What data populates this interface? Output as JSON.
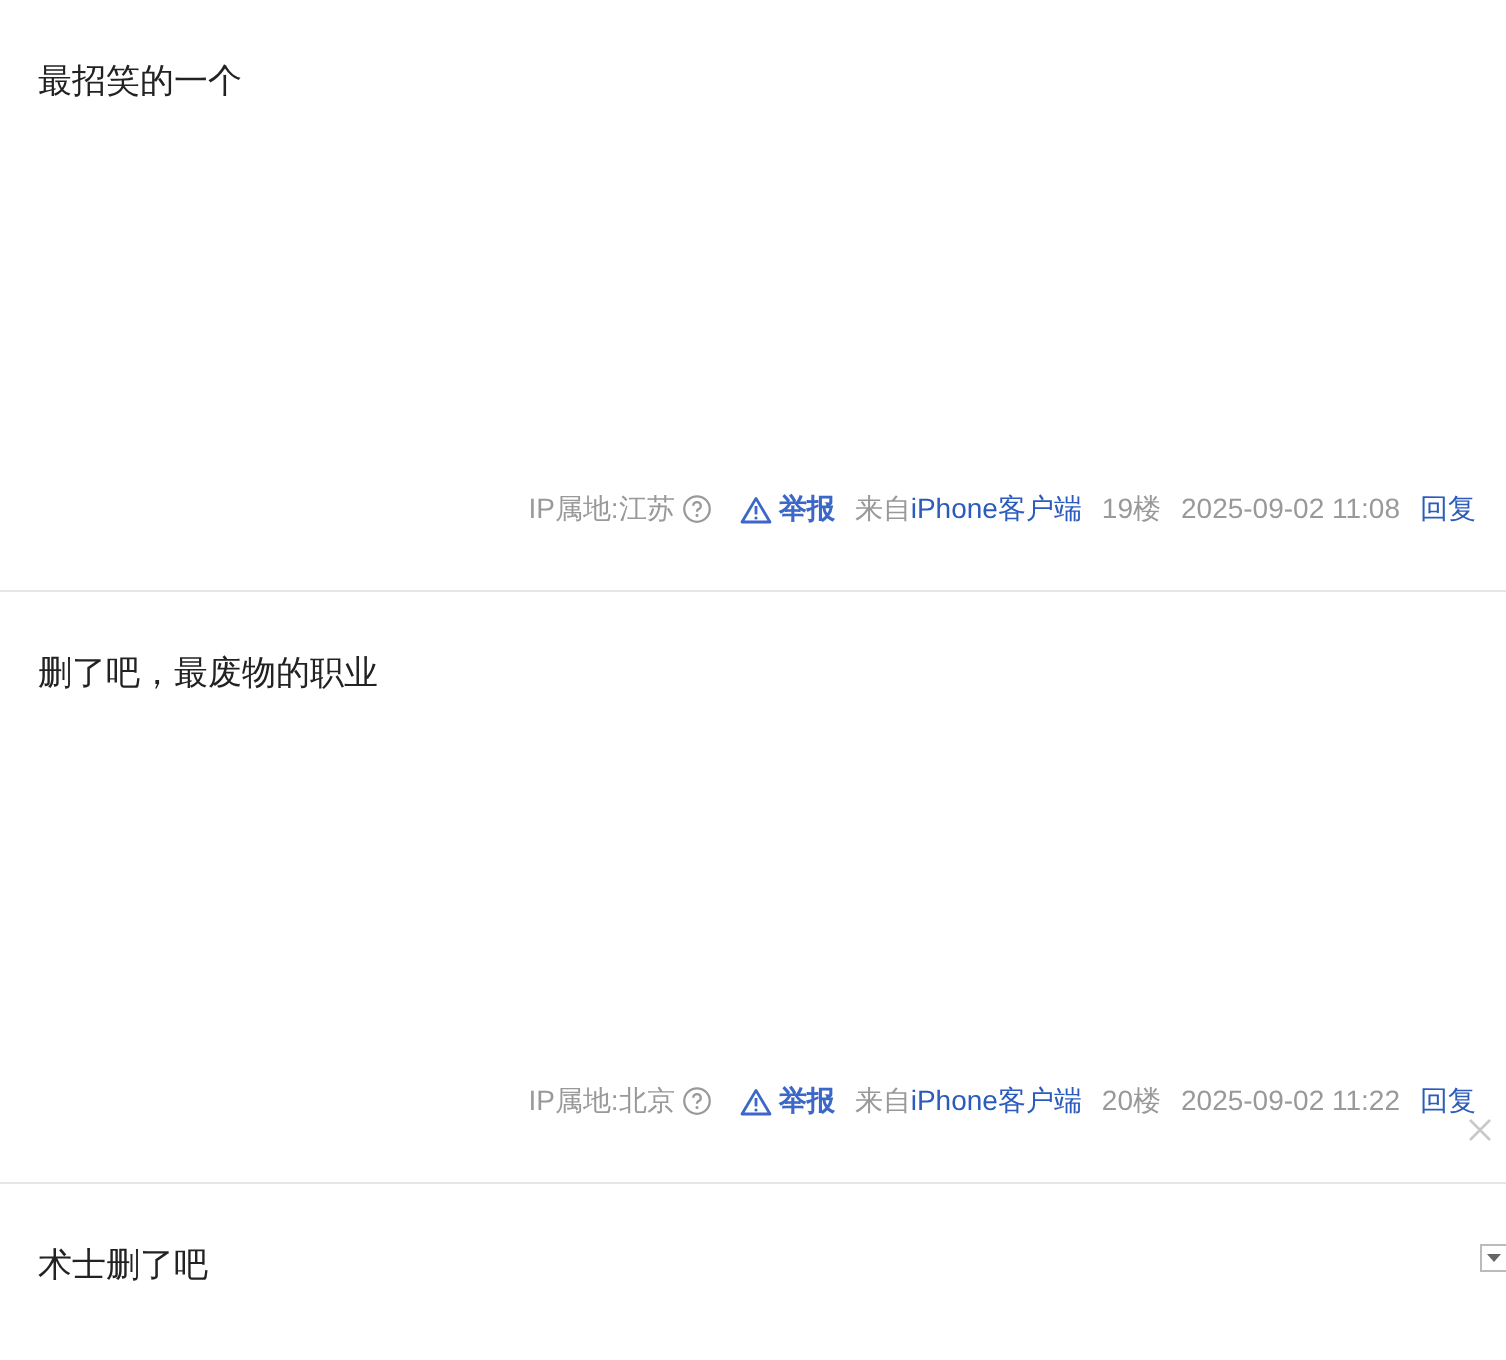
{
  "posts": [
    {
      "content": "最招笑的一个",
      "ip_location": "IP属地:江苏",
      "report": "举报",
      "source_prefix": "来自",
      "source": "iPhone客户端",
      "floor": "19楼",
      "time": "2025-09-02 11:08",
      "reply": "回复"
    },
    {
      "content": "删了吧，最废物的职业",
      "ip_location": "IP属地:北京",
      "report": "举报",
      "source_prefix": "来自",
      "source": "iPhone客户端",
      "floor": "20楼",
      "time": "2025-09-02 11:22",
      "reply": "回复"
    },
    {
      "content": "术士删了吧"
    }
  ]
}
